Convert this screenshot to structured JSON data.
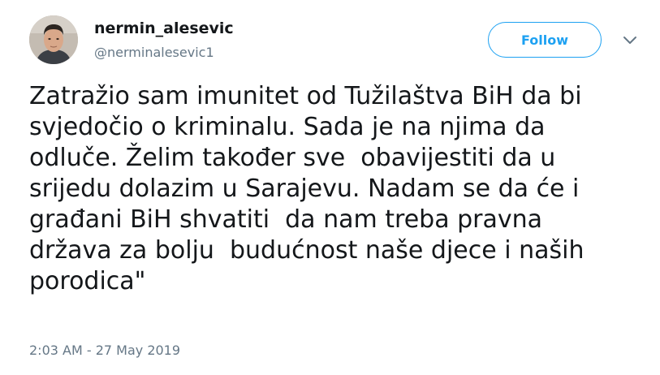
{
  "user": {
    "display_name": "nermin_alesevic",
    "handle": "@nerminalesevic1"
  },
  "actions": {
    "follow_label": "Follow",
    "menu_icon": "chevron-down-icon"
  },
  "tweet": {
    "lines": [
      "Zatražio sam imunitet od Tužilaštva BiH da bi",
      "svjedočio o kriminalu. Sada je na njima da",
      "odluče. Želim također sve  obavijestiti da u",
      "srijedu dolazim u Sarajevu. Nadam se da će i",
      "građani BiH shvatiti  da nam treba pravna",
      "država za bolju  budućnost naše djece i naših",
      "porodica\""
    ],
    "timestamp": "2:03 AM - 27 May 2019"
  },
  "colors": {
    "accent": "#1da1f2",
    "text": "#14171a",
    "muted": "#657786",
    "background": "#ffffff"
  }
}
